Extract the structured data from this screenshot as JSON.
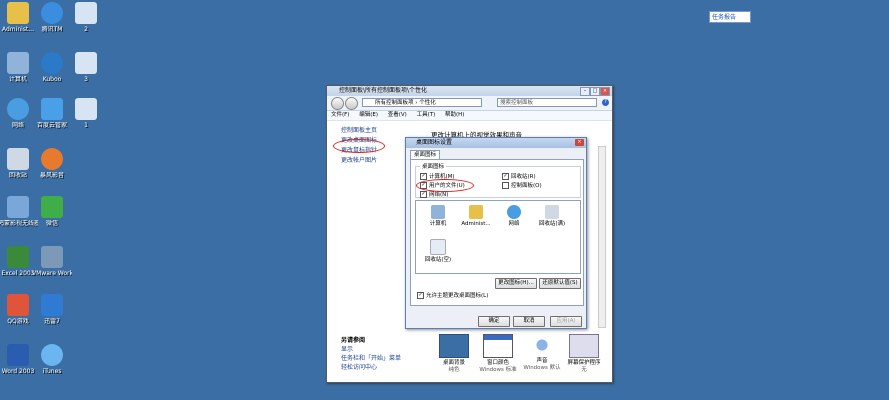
{
  "desktop": {
    "icons": [
      {
        "label": "Administ...",
        "kind": "folder",
        "color": "#e7c04a",
        "col": 0,
        "row": 0
      },
      {
        "label": "腾讯TM",
        "kind": "chat",
        "color": "#3b8de0",
        "col": 1,
        "row": 0
      },
      {
        "label": "2",
        "kind": "window",
        "color": "#d6e4f4",
        "col": 2,
        "row": 0
      },
      {
        "label": "计算机",
        "kind": "computer",
        "color": "#8fb3d9",
        "col": 0,
        "row": 1
      },
      {
        "label": "Kuboo",
        "kind": "k",
        "color": "#2b79c9",
        "col": 1,
        "row": 1
      },
      {
        "label": "3",
        "kind": "window",
        "color": "#d6e4f4",
        "col": 2,
        "row": 1
      },
      {
        "label": "网络",
        "kind": "globe",
        "color": "#4a9de0",
        "col": 0,
        "row": 2
      },
      {
        "label": "百度云管家",
        "kind": "cloud",
        "color": "#4aa0e8",
        "col": 1,
        "row": 2
      },
      {
        "label": "1",
        "kind": "window",
        "color": "#d6e4f4",
        "col": 2,
        "row": 2
      },
      {
        "label": "回收站",
        "kind": "bin",
        "color": "#cfd9e6",
        "col": 0,
        "row": 3
      },
      {
        "label": "暴风影音",
        "kind": "player",
        "color": "#e77a2c",
        "col": 1,
        "row": 3
      },
      {
        "label": "鸿蒙影视无线器",
        "kind": "folder",
        "color": "#7aa7d9",
        "col": 0,
        "row": 4
      },
      {
        "label": "微信",
        "kind": "wechat",
        "color": "#3fae49",
        "col": 1,
        "row": 4
      },
      {
        "label": "Excel 2003",
        "kind": "excel",
        "color": "#3a8a3a",
        "col": 0,
        "row": 5
      },
      {
        "label": "VMware Workstation",
        "kind": "vm",
        "color": "#7c9ab8",
        "col": 1,
        "row": 5
      },
      {
        "label": "QQ游戏",
        "kind": "game",
        "color": "#e0553a",
        "col": 0,
        "row": 6
      },
      {
        "label": "迅雷7",
        "kind": "bird",
        "color": "#2f7ad3",
        "col": 1,
        "row": 6
      },
      {
        "label": "Word 2003",
        "kind": "word",
        "color": "#2a5db0",
        "col": 0,
        "row": 7
      },
      {
        "label": "iTunes",
        "kind": "music",
        "color": "#6bb6f0",
        "col": 1,
        "row": 7
      }
    ],
    "taskbar_chip": "任务报告"
  },
  "window": {
    "title": "控制面板\\所有控制面板项\\个性化",
    "address": "所有控制面板项 › 个性化",
    "search_placeholder": "搜索控制面板",
    "menu": [
      "文件(F)",
      "编辑(E)",
      "查看(V)",
      "工具(T)",
      "帮助(H)"
    ],
    "side_links": [
      "控制面板主页",
      "更改桌面图标",
      "更改鼠标指针",
      "更改帐户图片"
    ],
    "main_title": "更改计算机上的视觉效果和声音",
    "see_also_header": "另请参阅",
    "see_also": [
      "显示",
      "任务栏和「开始」菜单",
      "轻松访问中心"
    ],
    "bottom_items": [
      {
        "label": "桌面背景",
        "sub": "纯色"
      },
      {
        "label": "窗口颜色",
        "sub": "Windows 标准"
      },
      {
        "label": "声音",
        "sub": "Windows 默认"
      },
      {
        "label": "屏幕保护程序",
        "sub": "无"
      }
    ]
  },
  "dialog": {
    "title": "桌面图标设置",
    "tab": "桌面图标",
    "group_title": "桌面图标",
    "checkboxes": [
      {
        "label": "计算机(M)",
        "checked": true
      },
      {
        "label": "回收站(R)",
        "checked": true
      },
      {
        "label": "用户的文件(U)",
        "checked": true
      },
      {
        "label": "控制面板(O)",
        "checked": false
      },
      {
        "label": "网络(N)",
        "checked": true
      }
    ],
    "icons": [
      "计算机",
      "Administ...",
      "网络",
      "回收站(满)",
      "回收站(空)"
    ],
    "change_icon": "更改图标(H)...",
    "restore_default": "还原默认值(S)",
    "allow_themes": "允许主题更改桌面图标(L)",
    "ok": "确定",
    "cancel": "取消",
    "apply": "应用(A)"
  }
}
